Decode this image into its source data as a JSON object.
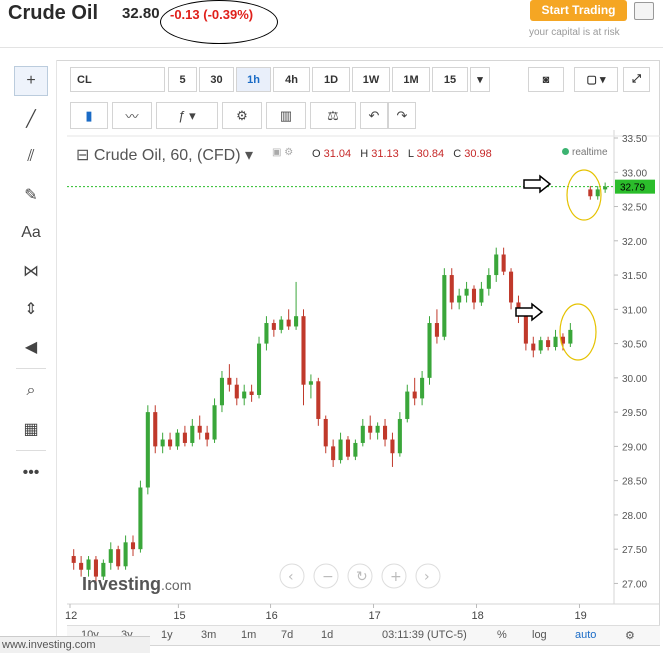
{
  "header": {
    "title": "Crude Oil",
    "price": "32.80",
    "change": "-0.13 (-0.39%)",
    "start_trading": "Start Trading",
    "capital_risk": "your capital is at risk"
  },
  "toolbar": {
    "symbol": "CL",
    "intervals": [
      "5",
      "30",
      "1h",
      "4h",
      "1D",
      "1W",
      "1M",
      "15"
    ],
    "selected_interval": "1h"
  },
  "legend": {
    "symbol": "Crude Oil, 60, (CFD)",
    "o_label": "O",
    "o_val": "31.04",
    "h_label": "H",
    "h_val": "31.13",
    "l_label": "L",
    "l_val": "30.84",
    "c_label": "C",
    "c_val": "30.98",
    "realtime": "realtime"
  },
  "bottom": {
    "ranges": [
      "10y",
      "3y",
      "1y",
      "3m",
      "1m",
      "7d",
      "1d"
    ],
    "time": "03:11:39 (UTC-5)",
    "pct": "%",
    "log": "log",
    "auto": "auto"
  },
  "logo": {
    "brand": "Investing",
    "dom": ".com"
  },
  "status_url": "www.investing.com",
  "colors": {
    "up": "#3aa63a",
    "down": "#c0392b",
    "price_line": "#2bbd2b",
    "accent": "#1a6bc6"
  },
  "chart_data": {
    "type": "candlestick",
    "title": "Crude Oil, 60, (CFD)",
    "ylim": [
      26.7,
      33.5
    ],
    "yticks": [
      "27.00",
      "27.50",
      "28.00",
      "28.50",
      "29.00",
      "29.50",
      "30.00",
      "30.50",
      "31.00",
      "31.50",
      "32.00",
      "32.50",
      "33.00",
      "33.50"
    ],
    "xticks": [
      {
        "label": "12",
        "pos": 0.0
      },
      {
        "label": "15",
        "pos": 0.2
      },
      {
        "label": "16",
        "pos": 0.37
      },
      {
        "label": "17",
        "pos": 0.56
      },
      {
        "label": "18",
        "pos": 0.75
      },
      {
        "label": "19",
        "pos": 0.94
      }
    ],
    "last_price": "32.79",
    "candles": [
      [
        27.4,
        27.5,
        27.2,
        27.3
      ],
      [
        27.3,
        27.4,
        27.1,
        27.2
      ],
      [
        27.2,
        27.4,
        27.1,
        27.35
      ],
      [
        27.35,
        27.4,
        27.0,
        27.1
      ],
      [
        27.1,
        27.35,
        27.05,
        27.3
      ],
      [
        27.3,
        27.6,
        27.2,
        27.5
      ],
      [
        27.5,
        27.55,
        27.2,
        27.25
      ],
      [
        27.25,
        27.7,
        27.2,
        27.6
      ],
      [
        27.6,
        27.7,
        27.4,
        27.5
      ],
      [
        27.5,
        28.5,
        27.45,
        28.4
      ],
      [
        28.4,
        29.6,
        28.3,
        29.5
      ],
      [
        29.5,
        29.6,
        28.9,
        29.0
      ],
      [
        29.0,
        29.2,
        28.9,
        29.1
      ],
      [
        29.1,
        29.2,
        28.95,
        29.0
      ],
      [
        29.0,
        29.25,
        28.95,
        29.2
      ],
      [
        29.2,
        29.3,
        29.0,
        29.05
      ],
      [
        29.05,
        29.4,
        29.0,
        29.3
      ],
      [
        29.3,
        29.45,
        29.1,
        29.2
      ],
      [
        29.2,
        29.3,
        29.0,
        29.1
      ],
      [
        29.1,
        29.7,
        29.05,
        29.6
      ],
      [
        29.6,
        30.1,
        29.5,
        30.0
      ],
      [
        30.0,
        30.2,
        29.8,
        29.9
      ],
      [
        29.9,
        30.0,
        29.6,
        29.7
      ],
      [
        29.7,
        29.9,
        29.6,
        29.8
      ],
      [
        29.8,
        29.9,
        29.65,
        29.75
      ],
      [
        29.75,
        30.6,
        29.7,
        30.5
      ],
      [
        30.5,
        30.9,
        30.4,
        30.8
      ],
      [
        30.8,
        30.85,
        30.6,
        30.7
      ],
      [
        30.7,
        30.9,
        30.65,
        30.85
      ],
      [
        30.85,
        31.0,
        30.7,
        30.75
      ],
      [
        30.75,
        31.4,
        30.7,
        30.9
      ],
      [
        30.9,
        31.0,
        29.6,
        29.9
      ],
      [
        29.9,
        30.05,
        29.7,
        29.95
      ],
      [
        29.95,
        30.0,
        29.3,
        29.4
      ],
      [
        29.4,
        29.45,
        28.9,
        29.0
      ],
      [
        29.0,
        29.1,
        28.7,
        28.8
      ],
      [
        28.8,
        29.2,
        28.75,
        29.1
      ],
      [
        29.1,
        29.15,
        28.8,
        28.85
      ],
      [
        28.85,
        29.1,
        28.8,
        29.05
      ],
      [
        29.05,
        29.4,
        29.0,
        29.3
      ],
      [
        29.3,
        29.45,
        29.1,
        29.2
      ],
      [
        29.2,
        29.35,
        29.1,
        29.3
      ],
      [
        29.3,
        29.4,
        29.0,
        29.1
      ],
      [
        29.1,
        29.2,
        28.7,
        28.9
      ],
      [
        28.9,
        29.5,
        28.85,
        29.4
      ],
      [
        29.4,
        29.9,
        29.35,
        29.8
      ],
      [
        29.8,
        30.0,
        29.6,
        29.7
      ],
      [
        29.7,
        30.1,
        29.6,
        30.0
      ],
      [
        30.0,
        30.9,
        29.9,
        30.8
      ],
      [
        30.8,
        31.0,
        30.5,
        30.6
      ],
      [
        30.6,
        31.6,
        30.55,
        31.5
      ],
      [
        31.5,
        31.6,
        31.0,
        31.1
      ],
      [
        31.1,
        31.3,
        31.0,
        31.2
      ],
      [
        31.2,
        31.4,
        31.1,
        31.3
      ],
      [
        31.3,
        31.35,
        31.0,
        31.1
      ],
      [
        31.1,
        31.4,
        31.05,
        31.3
      ],
      [
        31.3,
        31.6,
        31.2,
        31.5
      ],
      [
        31.5,
        31.9,
        31.4,
        31.8
      ],
      [
        31.8,
        31.9,
        31.5,
        31.55
      ],
      [
        31.55,
        31.6,
        31.0,
        31.1
      ],
      [
        31.1,
        31.2,
        30.8,
        30.9
      ],
      [
        30.9,
        31.0,
        30.4,
        30.5
      ],
      [
        30.5,
        30.6,
        30.3,
        30.4
      ],
      [
        30.4,
        30.6,
        30.35,
        30.55
      ],
      [
        30.55,
        30.6,
        30.4,
        30.45
      ],
      [
        30.45,
        30.7,
        30.4,
        30.6
      ],
      [
        30.6,
        30.65,
        30.4,
        30.5
      ],
      [
        30.5,
        30.8,
        30.45,
        30.7
      ]
    ],
    "gap_candles": [
      [
        32.75,
        32.8,
        32.6,
        32.65
      ],
      [
        32.65,
        32.8,
        32.6,
        32.75
      ],
      [
        32.75,
        32.85,
        32.7,
        32.79
      ]
    ]
  }
}
